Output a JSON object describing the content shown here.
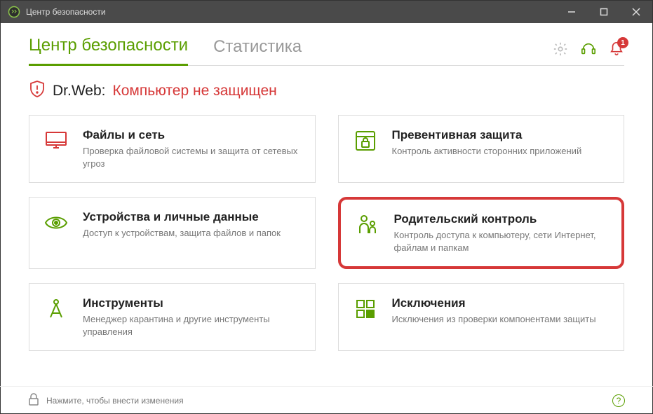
{
  "window": {
    "title": "Центр безопасности"
  },
  "tabs": {
    "security": "Центр безопасности",
    "stats": "Статистика"
  },
  "notifications": {
    "count": "1"
  },
  "status": {
    "brand": "Dr.Web:",
    "message": "Компьютер не защищен"
  },
  "cards": {
    "files": {
      "title": "Файлы и сеть",
      "desc": "Проверка файловой системы и защита от сетевых угроз"
    },
    "prevent": {
      "title": "Превентивная защита",
      "desc": "Контроль активности сторонних приложений"
    },
    "devices": {
      "title": "Устройства и личные данные",
      "desc": "Доступ к устройствам, защита файлов и папок"
    },
    "parental": {
      "title": "Родительский контроль",
      "desc": "Контроль доступа к компьютеру, сети Интернет, файлам и папкам"
    },
    "tools": {
      "title": "Инструменты",
      "desc": "Менеджер карантина и другие инструменты управления"
    },
    "excl": {
      "title": "Исключения",
      "desc": "Исключения из проверки компонентами защиты"
    }
  },
  "footer": {
    "lock_text": "Нажмите, чтобы внести изменения"
  },
  "colors": {
    "accent": "#5a9e00",
    "danger": "#d63838"
  }
}
